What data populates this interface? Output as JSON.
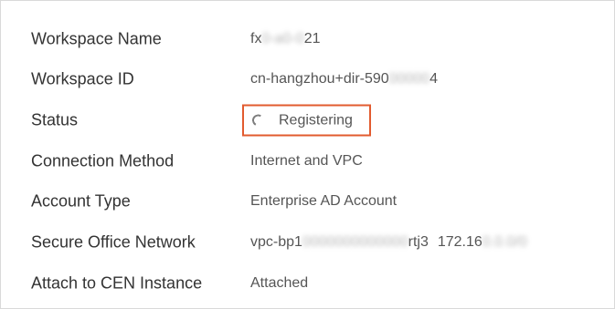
{
  "rows": {
    "name": {
      "label": "Workspace Name",
      "value_prefix": "fx",
      "value_redacted": "0-a0-0",
      "value_suffix": "21"
    },
    "id": {
      "label": "Workspace ID",
      "value_prefix": "cn-hangzhou+dir-590",
      "value_redacted": "00000",
      "value_suffix": "4"
    },
    "status": {
      "label": "Status",
      "value": "Registering",
      "icon": "loading-spinner-icon",
      "highlight_color": "#e25b2f"
    },
    "connection": {
      "label": "Connection Method",
      "value": "Internet and VPC"
    },
    "account": {
      "label": "Account Type",
      "value": "Enterprise AD Account"
    },
    "network": {
      "label": "Secure Office Network",
      "value_prefix": "vpc-bp1",
      "value_redacted": "0000000000000",
      "value_suffix": "rtj3",
      "ip_prefix": "172.16",
      "ip_redacted": "0.0.0/0"
    },
    "cen": {
      "label": "Attach to CEN Instance",
      "value": "Attached"
    }
  }
}
